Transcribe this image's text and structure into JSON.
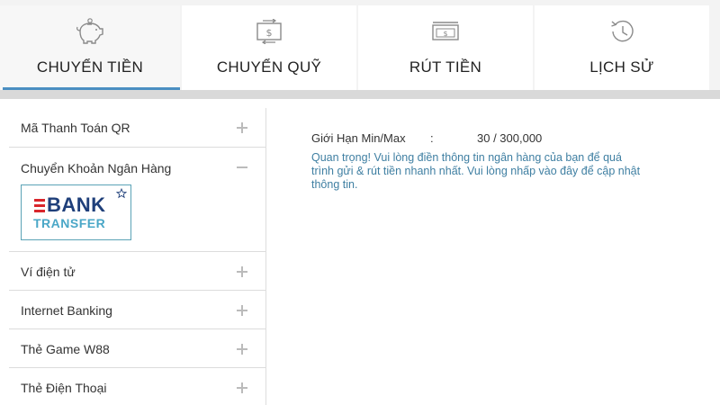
{
  "tabs": [
    {
      "label": "CHUYỂN TIỀN",
      "icon": "piggy-bank-icon",
      "active": true
    },
    {
      "label": "CHUYỂN QUỸ",
      "icon": "money-transfer-icon",
      "active": false
    },
    {
      "label": "RÚT TIỀN",
      "icon": "cash-withdraw-icon",
      "active": false
    },
    {
      "label": "LỊCH SỬ",
      "icon": "history-clock-icon",
      "active": false
    }
  ],
  "sidebar": {
    "items": [
      {
        "label": "Mã Thanh Toán QR",
        "toggle": "+"
      },
      {
        "label": "Chuyển Khoản Ngân Hàng",
        "toggle": "−",
        "expanded": true,
        "logo": {
          "line1": "BANK",
          "line2": "TRANSFER"
        }
      },
      {
        "label": "Ví điện tử",
        "toggle": "+"
      },
      {
        "label": "Internet Banking",
        "toggle": "+"
      },
      {
        "label": "Thẻ Game W88",
        "toggle": "+"
      },
      {
        "label": "Thẻ Điện Thoại",
        "toggle": "+"
      }
    ]
  },
  "main": {
    "limit_label": "Giới Hạn Min/Max",
    "limit_separator": ":",
    "limit_value": "30 / 300,000",
    "notice": "Quan trọng! Vui lòng điền thông tin ngân hàng của bạn để quá trình gửi & rút tiền nhanh nhất. Vui lòng nhấp vào đây để cập nhật thông tin."
  },
  "colors": {
    "accent": "#4a8fc2",
    "notice_text": "#3f7fa2",
    "logo_red": "#d9262c",
    "logo_navy": "#1f3f7a",
    "logo_teal": "#4aa7c7"
  }
}
